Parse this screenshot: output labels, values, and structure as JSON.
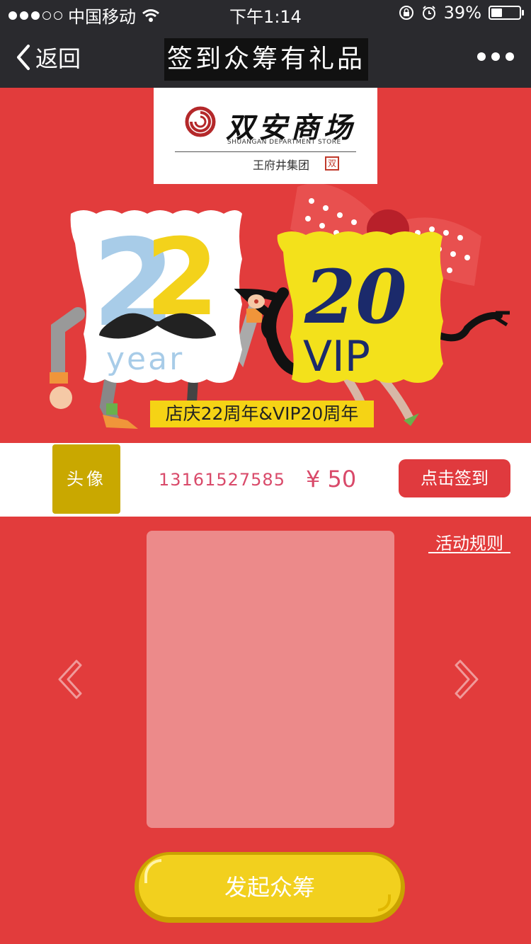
{
  "status_bar": {
    "carrier": "中国移动",
    "time": "下午1:14",
    "battery_percent": "39%",
    "battery_level": 0.39,
    "signal_bars_filled": 3,
    "signal_bars_total": 5
  },
  "nav": {
    "back_label": "返回",
    "title": "签到众筹有礼品"
  },
  "banner": {
    "logo_cn": "双安商场",
    "logo_en": "SHUANGAN DEPARTMENT STORE",
    "logo_group": "王府井集团",
    "art_22": "22",
    "art_year": "year",
    "art_20": "20",
    "art_vip": "VIP",
    "anniversary_text": "店庆22周年&VIP20周年"
  },
  "user": {
    "avatar_label": "头像",
    "phone": "13161527585",
    "amount": "¥ 50",
    "signin_label": "点击签到"
  },
  "main": {
    "rules_label": "活动规则",
    "launch_label": "发起众筹"
  },
  "colors": {
    "page_bg": "#e23c3c",
    "topbar_bg": "#2a2a2e",
    "avatar_bg": "#c9a800",
    "accent_text": "#d94a6a",
    "button_red": "#e03a3e",
    "card": "#ec8a8a",
    "launch_yellow": "#f2d01e"
  },
  "icons": [
    "wifi-icon",
    "lock-rotation-icon",
    "alarm-icon",
    "battery-icon",
    "back-chevron-icon",
    "more-icon",
    "arrow-left-icon",
    "arrow-right-icon"
  ]
}
